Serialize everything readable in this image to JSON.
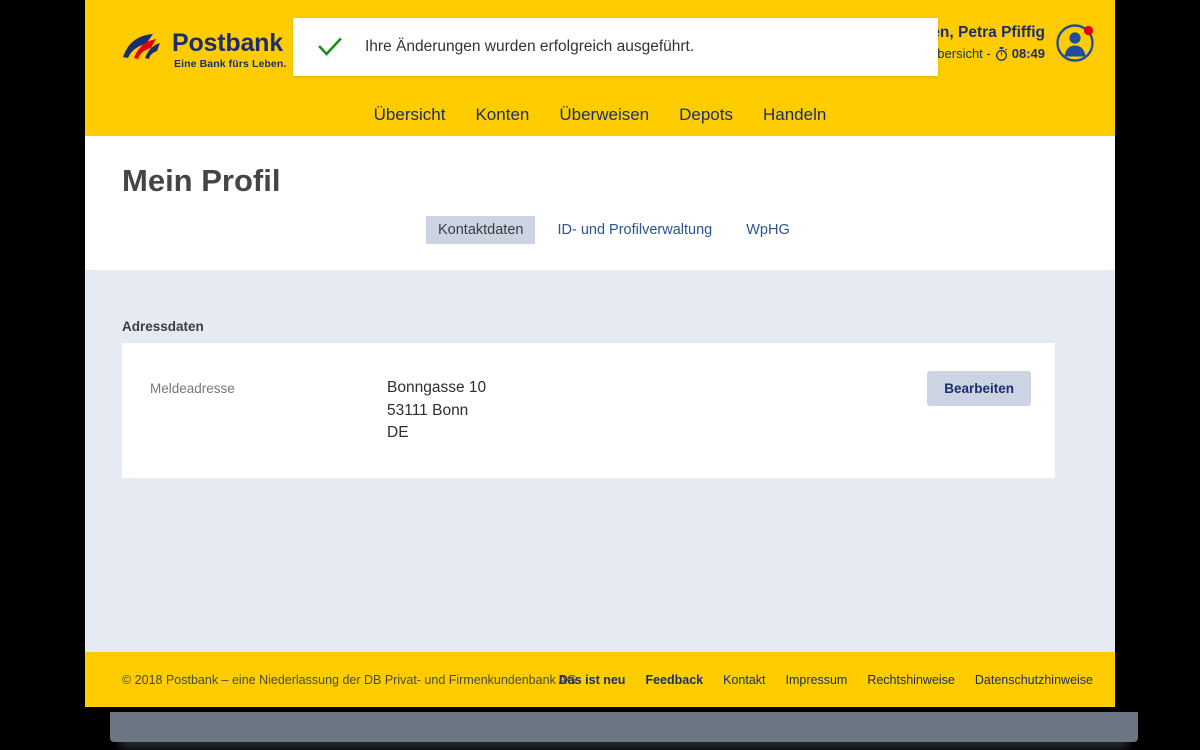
{
  "brand": {
    "name": "Postbank",
    "claim": "Eine Bank fürs Leben.",
    "logo_icon": "postbank-swoosh-icon",
    "yellow": "#ffcc00",
    "navy": "#1a2e6e",
    "red": "#e3000f"
  },
  "toast": {
    "icon": "check-icon",
    "icon_color": "#1c8a1c",
    "message": "Ihre Änderungen wurden erfolgreich ausgeführt."
  },
  "user": {
    "greeting": "en, Petra Pfiffig",
    "session_label": "übersicht -",
    "timer_icon": "stopwatch-icon",
    "session_time": "08:49",
    "avatar_icon": "user-avatar-icon",
    "avatar_badge_color": "#e3000f"
  },
  "nav": {
    "items": [
      {
        "label": "Übersicht"
      },
      {
        "label": "Konten"
      },
      {
        "label": "Überweisen"
      },
      {
        "label": "Depots"
      },
      {
        "label": "Handeln"
      }
    ]
  },
  "page": {
    "title": "Mein Profil"
  },
  "tabs": [
    {
      "label": "Kontaktdaten",
      "active": true
    },
    {
      "label": "ID- und Profilverwaltung",
      "active": false
    },
    {
      "label": "WpHG",
      "active": false
    }
  ],
  "section": {
    "label": "Adressdaten",
    "rows": [
      {
        "label": "Meldeadresse",
        "line1": "Bonngasse 10",
        "line2": "53111 Bonn",
        "line3": "DE",
        "action_label": "Bearbeiten"
      }
    ]
  },
  "footer": {
    "copyright": "© 2018 Postbank – eine Niederlassung der DB Privat- und Firmenkundenbank AG",
    "links": [
      {
        "label": "Das ist neu",
        "bold": true
      },
      {
        "label": "Feedback",
        "bold": true
      },
      {
        "label": "Kontakt",
        "bold": false
      },
      {
        "label": "Impressum",
        "bold": false
      },
      {
        "label": "Rechtshinweise",
        "bold": false
      },
      {
        "label": "Datenschutzhinweise",
        "bold": false
      }
    ]
  }
}
